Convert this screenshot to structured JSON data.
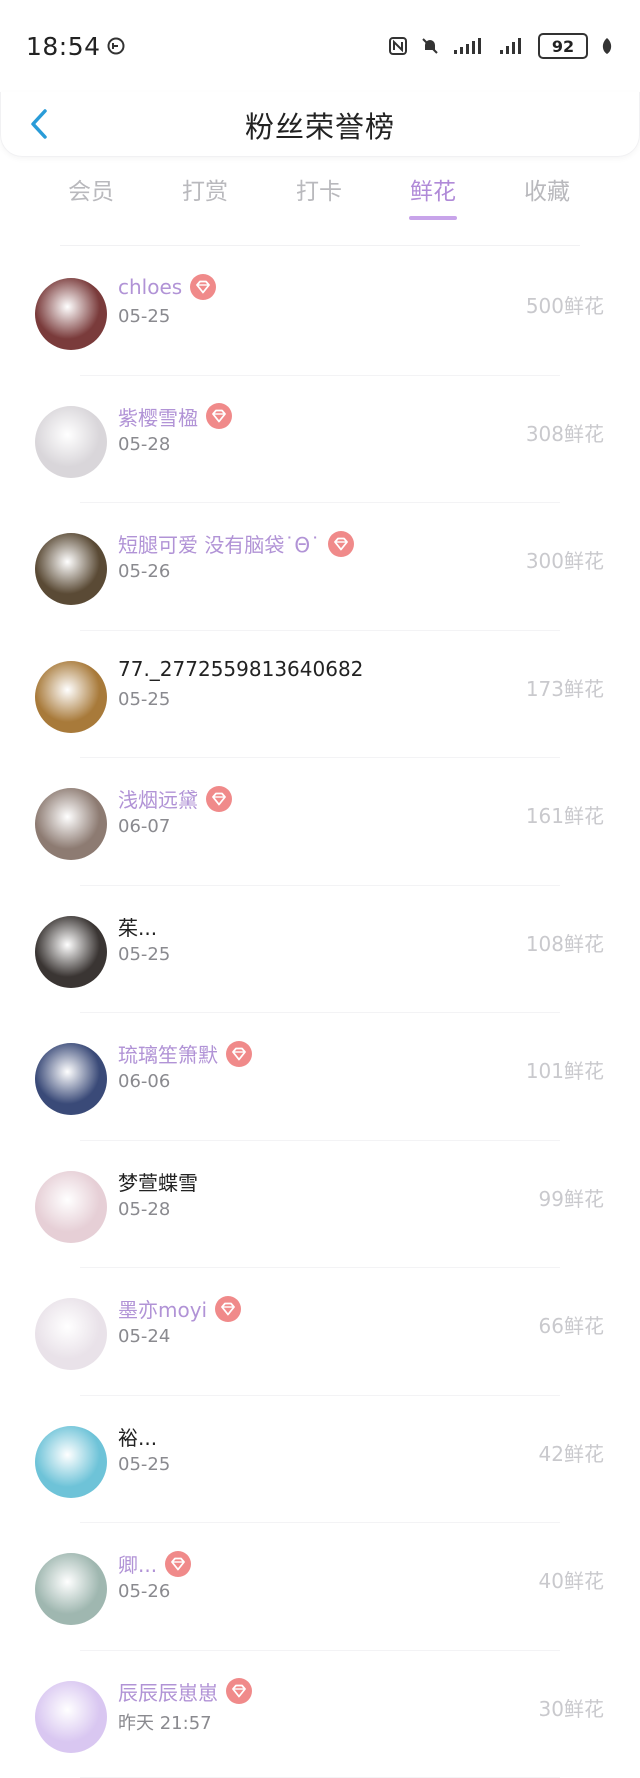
{
  "status": {
    "time": "18:54",
    "battery": "92"
  },
  "header": {
    "title": "粉丝荣誉榜"
  },
  "tabs": [
    {
      "label": "会员",
      "active": false
    },
    {
      "label": "打赏",
      "active": false
    },
    {
      "label": "打卡",
      "active": false
    },
    {
      "label": "鲜花",
      "active": true
    },
    {
      "label": "收藏",
      "active": false
    }
  ],
  "list": [
    {
      "name": "chloes",
      "date": "05-25",
      "count": "500鲜花",
      "vip": true,
      "avatar": "#7a3b3b"
    },
    {
      "name": "紫樱雪楹",
      "date": "05-28",
      "count": "308鲜花",
      "vip": true,
      "avatar": "#d9d6da"
    },
    {
      "name": "短腿可爱 没有脑袋˙Θ˙",
      "date": "05-26",
      "count": "300鲜花",
      "vip": true,
      "avatar": "#5a4a35"
    },
    {
      "name": "77._2772559813640682",
      "date": "05-25",
      "count": "173鲜花",
      "vip": false,
      "avatar": "#a87a3a"
    },
    {
      "name": "浅烟远黛",
      "date": "06-07",
      "count": "161鲜花",
      "vip": true,
      "avatar": "#8d7b72"
    },
    {
      "name": "茱...",
      "date": "05-25",
      "count": "108鲜花",
      "vip": false,
      "avatar": "#3a3533"
    },
    {
      "name": "琉璃笙箫默",
      "date": "06-06",
      "count": "101鲜花",
      "vip": true,
      "avatar": "#3a4a78"
    },
    {
      "name": "梦萱蝶雪",
      "date": "05-28",
      "count": "99鲜花",
      "vip": false,
      "avatar": "#e6cfd6"
    },
    {
      "name": "墨亦moyi",
      "date": "05-24",
      "count": "66鲜花",
      "vip": true,
      "avatar": "#e9e2e9"
    },
    {
      "name": "裕...",
      "date": "05-25",
      "count": "42鲜花",
      "vip": false,
      "avatar": "#6ec3d8"
    },
    {
      "name": "卿...",
      "date": "05-26",
      "count": "40鲜花",
      "vip": true,
      "avatar": "#9fb7b0"
    },
    {
      "name": "辰辰辰崽崽",
      "date": "昨天 21:57",
      "count": "30鲜花",
      "vip": true,
      "avatar": "#d9c7f1"
    }
  ]
}
